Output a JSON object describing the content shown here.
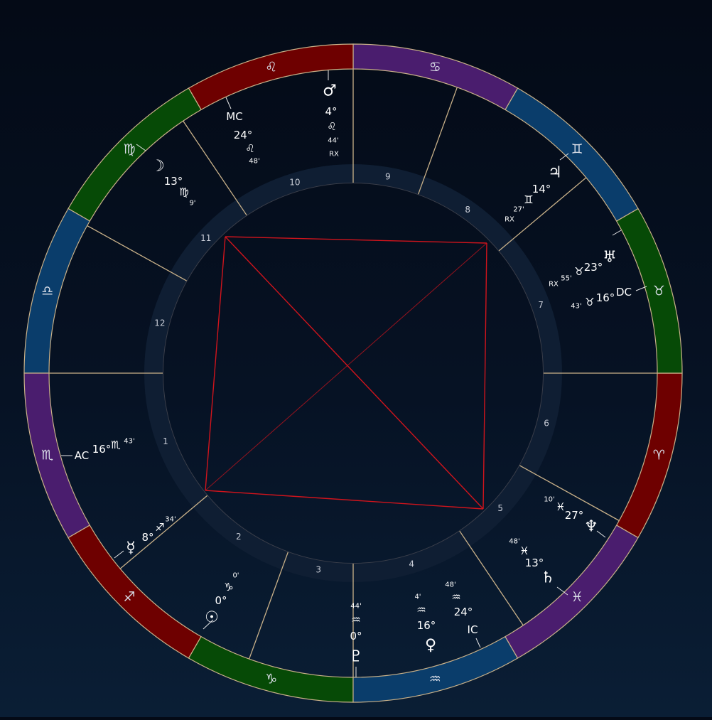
{
  "colors": {
    "fire": "#6e0000",
    "earth": "#064a06",
    "air": "#0a3d6b",
    "water": "#4a1d6e",
    "ring_band": "#0f1e33",
    "house_line": "#c9b189",
    "aspect_red": "#d0141c",
    "glyph_red": "#e0363c",
    "glyph_green": "#45b23a",
    "glyph_blue": "#2f90e0",
    "glyph_purple": "#8f45e6"
  },
  "signs": [
    {
      "name": "aries",
      "glyph": "♈",
      "element": "fire"
    },
    {
      "name": "taurus",
      "glyph": "♉",
      "element": "earth"
    },
    {
      "name": "gemini",
      "glyph": "♊",
      "element": "air"
    },
    {
      "name": "cancer",
      "glyph": "♋",
      "element": "water"
    },
    {
      "name": "leo",
      "glyph": "♌",
      "element": "fire"
    },
    {
      "name": "virgo",
      "glyph": "♍",
      "element": "earth"
    },
    {
      "name": "libra",
      "glyph": "♎",
      "element": "air"
    },
    {
      "name": "scorpio",
      "glyph": "♏",
      "element": "water"
    },
    {
      "name": "sagittarius",
      "glyph": "♐",
      "element": "fire"
    },
    {
      "name": "capricorn",
      "glyph": "♑",
      "element": "earth"
    },
    {
      "name": "aquarius",
      "glyph": "♒",
      "element": "air"
    },
    {
      "name": "pisces",
      "glyph": "♓",
      "element": "water"
    }
  ],
  "houses": [
    {
      "number": "1"
    },
    {
      "number": "2"
    },
    {
      "number": "3"
    },
    {
      "number": "4"
    },
    {
      "number": "5"
    },
    {
      "number": "6"
    },
    {
      "number": "7"
    },
    {
      "number": "8"
    },
    {
      "number": "9"
    },
    {
      "number": "10"
    },
    {
      "number": "11"
    },
    {
      "number": "12"
    }
  ],
  "angles": [
    {
      "id": "ac",
      "label": "AC",
      "degree": "16°",
      "sign_glyph": "♏",
      "minute": "43'",
      "color": "glyph_purple"
    },
    {
      "id": "mc",
      "label": "MC",
      "degree": "24°",
      "sign_glyph": "♌",
      "minute": "48'",
      "color": "glyph_red"
    },
    {
      "id": "dc",
      "label": "DC",
      "degree": "16°",
      "sign_glyph": "♉",
      "minute": "43'",
      "color": "glyph_green"
    },
    {
      "id": "ic",
      "label": "IC",
      "degree": "24°",
      "sign_glyph": "♒",
      "minute": "48'",
      "color": "glyph_blue"
    }
  ],
  "planets": [
    {
      "id": "mars",
      "glyph": "♂",
      "degree": "4°",
      "sign_glyph": "♌",
      "minute": "44'",
      "retro": "RX",
      "color": "glyph_red"
    },
    {
      "id": "moon",
      "glyph": "☽",
      "degree": "13°",
      "sign_glyph": "♍",
      "minute": "9'",
      "retro": "",
      "color": "glyph_green"
    },
    {
      "id": "jupiter",
      "glyph": "♃",
      "degree": "14°",
      "sign_glyph": "♊",
      "minute": "27'",
      "retro": "RX",
      "color": "glyph_blue"
    },
    {
      "id": "uranus",
      "glyph": "♅",
      "degree": "23°",
      "sign_glyph": "♉",
      "minute": "55'",
      "retro": "RX",
      "color": "glyph_green"
    },
    {
      "id": "neptune",
      "glyph": "♆",
      "degree": "27°",
      "sign_glyph": "♓",
      "minute": "10'",
      "retro": "",
      "color": "glyph_purple"
    },
    {
      "id": "saturn",
      "glyph": "♄",
      "degree": "13°",
      "sign_glyph": "♓",
      "minute": "48'",
      "retro": "",
      "color": "glyph_purple"
    },
    {
      "id": "venus",
      "glyph": "♀",
      "degree": "16°",
      "sign_glyph": "♒",
      "minute": "4'",
      "retro": "",
      "color": "glyph_blue"
    },
    {
      "id": "pluto",
      "glyph": "♇",
      "degree": "0°",
      "sign_glyph": "♒",
      "minute": "44'",
      "retro": "",
      "color": "glyph_blue"
    },
    {
      "id": "sun",
      "glyph": "☉",
      "degree": "0°",
      "sign_glyph": "♑",
      "minute": "0'",
      "retro": "",
      "color": "glyph_green"
    },
    {
      "id": "mercury",
      "glyph": "☿",
      "degree": "8°",
      "sign_glyph": "♐",
      "minute": "34'",
      "retro": "",
      "color": "glyph_red"
    }
  ]
}
